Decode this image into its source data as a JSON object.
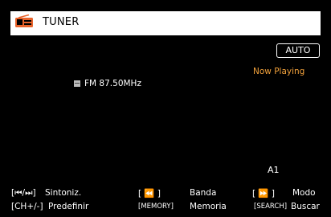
{
  "header": {
    "title": "TUNER",
    "icon": "radio-icon"
  },
  "badge": {
    "label": "AUTO"
  },
  "status": {
    "now_playing": "Now Playing"
  },
  "station": {
    "icon": "fm-band-icon",
    "label": "FM 87.50MHz"
  },
  "preset": {
    "label": "A1"
  },
  "footer": {
    "row1": [
      {
        "key": "[⏮/⏭]",
        "label": "Sintoniz."
      },
      {
        "key": "[ ⏪ ]",
        "label": "Banda"
      },
      {
        "key": "[ ⏩ ]",
        "label": "Modo"
      }
    ],
    "row2": [
      {
        "key": "[CH+/-]",
        "label": "Predefinir"
      },
      {
        "key": "[MEMORY]",
        "label": "Memoria"
      },
      {
        "key": "[SEARCH]",
        "label": "Buscar"
      }
    ]
  },
  "colors": {
    "accent": "#f1a13b",
    "background": "#000000",
    "header_bg": "#ffffff"
  }
}
